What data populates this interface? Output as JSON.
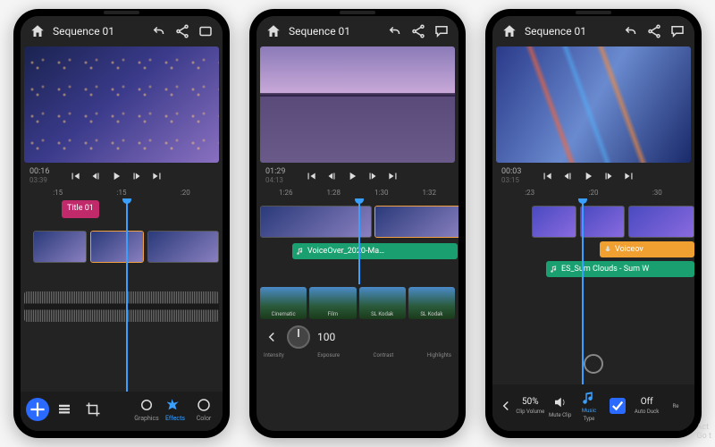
{
  "phones": [
    {
      "sequence_title": "Sequence 01",
      "timecode_main": "00:16",
      "timecode_sub": "03:39",
      "ruler": [
        ":15",
        ":15",
        ":20"
      ],
      "title_clip": "Title 01",
      "bottom_tabs": {
        "graphics": "Graphics",
        "effects": "Effects",
        "color": "Color"
      }
    },
    {
      "sequence_title": "Sequence 01",
      "timecode_main": "01:29",
      "timecode_sub": "04:13",
      "ruler": [
        "1:26",
        "1:28",
        "1:30",
        "1:32"
      ],
      "audio_label_1": "VoiceOver_2020-Ma…",
      "slider_value": "100",
      "slider_labels": {
        "intensity": "Intensity",
        "exposure": "Exposure",
        "contrast": "Contrast",
        "highlights": "Highlights"
      },
      "presets": [
        "Cinematic",
        "Film",
        "SL Kodak",
        "SL Kodak"
      ]
    },
    {
      "sequence_title": "Sequence 01",
      "timecode_main": "00:03",
      "timecode_sub": "03:15",
      "ruler": [
        ":23",
        ":20",
        ":30"
      ],
      "audio_label_1": "Voiceov",
      "audio_label_2": "ES_Sum Clouds - Sum W",
      "mix": {
        "clip_volume_val": "50%",
        "clip_volume": "Clip Volume",
        "mute_clip": "Mute Clip",
        "type_val": "Music",
        "type": "Type",
        "auto_duck_val": "Off",
        "auto_duck": "Auto Duck",
        "re": "Re"
      }
    }
  ],
  "watermark": {
    "l1": "Act",
    "l2": "Go t"
  }
}
